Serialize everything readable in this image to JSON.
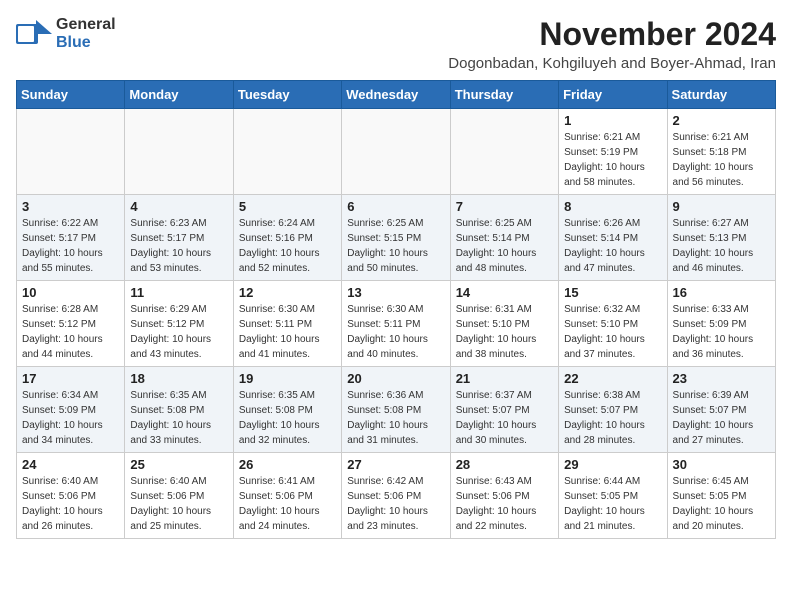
{
  "header": {
    "logo_general": "General",
    "logo_blue": "Blue",
    "month_title": "November 2024",
    "subtitle": "Dogonbadan, Kohgiluyeh and Boyer-Ahmad, Iran"
  },
  "weekdays": [
    "Sunday",
    "Monday",
    "Tuesday",
    "Wednesday",
    "Thursday",
    "Friday",
    "Saturday"
  ],
  "weeks": [
    [
      {
        "day": "",
        "info": ""
      },
      {
        "day": "",
        "info": ""
      },
      {
        "day": "",
        "info": ""
      },
      {
        "day": "",
        "info": ""
      },
      {
        "day": "",
        "info": ""
      },
      {
        "day": "1",
        "info": "Sunrise: 6:21 AM\nSunset: 5:19 PM\nDaylight: 10 hours\nand 58 minutes."
      },
      {
        "day": "2",
        "info": "Sunrise: 6:21 AM\nSunset: 5:18 PM\nDaylight: 10 hours\nand 56 minutes."
      }
    ],
    [
      {
        "day": "3",
        "info": "Sunrise: 6:22 AM\nSunset: 5:17 PM\nDaylight: 10 hours\nand 55 minutes."
      },
      {
        "day": "4",
        "info": "Sunrise: 6:23 AM\nSunset: 5:17 PM\nDaylight: 10 hours\nand 53 minutes."
      },
      {
        "day": "5",
        "info": "Sunrise: 6:24 AM\nSunset: 5:16 PM\nDaylight: 10 hours\nand 52 minutes."
      },
      {
        "day": "6",
        "info": "Sunrise: 6:25 AM\nSunset: 5:15 PM\nDaylight: 10 hours\nand 50 minutes."
      },
      {
        "day": "7",
        "info": "Sunrise: 6:25 AM\nSunset: 5:14 PM\nDaylight: 10 hours\nand 48 minutes."
      },
      {
        "day": "8",
        "info": "Sunrise: 6:26 AM\nSunset: 5:14 PM\nDaylight: 10 hours\nand 47 minutes."
      },
      {
        "day": "9",
        "info": "Sunrise: 6:27 AM\nSunset: 5:13 PM\nDaylight: 10 hours\nand 46 minutes."
      }
    ],
    [
      {
        "day": "10",
        "info": "Sunrise: 6:28 AM\nSunset: 5:12 PM\nDaylight: 10 hours\nand 44 minutes."
      },
      {
        "day": "11",
        "info": "Sunrise: 6:29 AM\nSunset: 5:12 PM\nDaylight: 10 hours\nand 43 minutes."
      },
      {
        "day": "12",
        "info": "Sunrise: 6:30 AM\nSunset: 5:11 PM\nDaylight: 10 hours\nand 41 minutes."
      },
      {
        "day": "13",
        "info": "Sunrise: 6:30 AM\nSunset: 5:11 PM\nDaylight: 10 hours\nand 40 minutes."
      },
      {
        "day": "14",
        "info": "Sunrise: 6:31 AM\nSunset: 5:10 PM\nDaylight: 10 hours\nand 38 minutes."
      },
      {
        "day": "15",
        "info": "Sunrise: 6:32 AM\nSunset: 5:10 PM\nDaylight: 10 hours\nand 37 minutes."
      },
      {
        "day": "16",
        "info": "Sunrise: 6:33 AM\nSunset: 5:09 PM\nDaylight: 10 hours\nand 36 minutes."
      }
    ],
    [
      {
        "day": "17",
        "info": "Sunrise: 6:34 AM\nSunset: 5:09 PM\nDaylight: 10 hours\nand 34 minutes."
      },
      {
        "day": "18",
        "info": "Sunrise: 6:35 AM\nSunset: 5:08 PM\nDaylight: 10 hours\nand 33 minutes."
      },
      {
        "day": "19",
        "info": "Sunrise: 6:35 AM\nSunset: 5:08 PM\nDaylight: 10 hours\nand 32 minutes."
      },
      {
        "day": "20",
        "info": "Sunrise: 6:36 AM\nSunset: 5:08 PM\nDaylight: 10 hours\nand 31 minutes."
      },
      {
        "day": "21",
        "info": "Sunrise: 6:37 AM\nSunset: 5:07 PM\nDaylight: 10 hours\nand 30 minutes."
      },
      {
        "day": "22",
        "info": "Sunrise: 6:38 AM\nSunset: 5:07 PM\nDaylight: 10 hours\nand 28 minutes."
      },
      {
        "day": "23",
        "info": "Sunrise: 6:39 AM\nSunset: 5:07 PM\nDaylight: 10 hours\nand 27 minutes."
      }
    ],
    [
      {
        "day": "24",
        "info": "Sunrise: 6:40 AM\nSunset: 5:06 PM\nDaylight: 10 hours\nand 26 minutes."
      },
      {
        "day": "25",
        "info": "Sunrise: 6:40 AM\nSunset: 5:06 PM\nDaylight: 10 hours\nand 25 minutes."
      },
      {
        "day": "26",
        "info": "Sunrise: 6:41 AM\nSunset: 5:06 PM\nDaylight: 10 hours\nand 24 minutes."
      },
      {
        "day": "27",
        "info": "Sunrise: 6:42 AM\nSunset: 5:06 PM\nDaylight: 10 hours\nand 23 minutes."
      },
      {
        "day": "28",
        "info": "Sunrise: 6:43 AM\nSunset: 5:06 PM\nDaylight: 10 hours\nand 22 minutes."
      },
      {
        "day": "29",
        "info": "Sunrise: 6:44 AM\nSunset: 5:05 PM\nDaylight: 10 hours\nand 21 minutes."
      },
      {
        "day": "30",
        "info": "Sunrise: 6:45 AM\nSunset: 5:05 PM\nDaylight: 10 hours\nand 20 minutes."
      }
    ]
  ]
}
